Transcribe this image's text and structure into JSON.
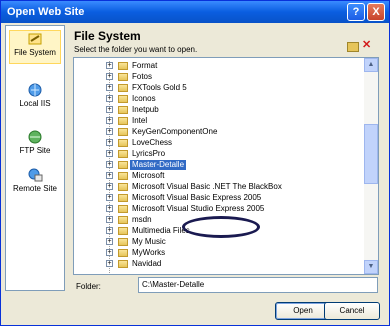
{
  "window": {
    "title": "Open Web Site"
  },
  "title_buttons": {
    "help": "?",
    "close": "X"
  },
  "nav": [
    {
      "label": "File System",
      "icon": "file-system-icon",
      "selected": true
    },
    {
      "label": "Local IIS",
      "icon": "local-iis-icon",
      "selected": false
    },
    {
      "label": "FTP Site",
      "icon": "ftp-site-icon",
      "selected": false
    },
    {
      "label": "Remote Site",
      "icon": "remote-site-icon",
      "selected": false
    }
  ],
  "main": {
    "heading": "File System",
    "instruction": "Select the folder you want to open."
  },
  "toolbar": {
    "new_folder_icon": "new-folder-icon",
    "delete_icon": "delete-icon"
  },
  "tree": {
    "rows": [
      "Format",
      "Fotos",
      "FXTools Gold 5",
      "Iconos",
      "Inetpub",
      "Intel",
      "KeyGenComponentOne",
      "LoveChess",
      "LyricsPro",
      "Master-Detalle",
      "Microsoft",
      "Microsoft Visual Basic .NET The BlackBox",
      "Microsoft Visual Basic Express 2005",
      "Microsoft Visual Studio Express 2005",
      "msdn",
      "Multimedia Files",
      "My Music",
      "MyWorks",
      "Navidad"
    ],
    "selected": "Master-Detalle"
  },
  "folder": {
    "label": "Folder:",
    "value": "C:\\Master-Detalle"
  },
  "buttons": {
    "open": "Open",
    "cancel": "Cancel"
  }
}
